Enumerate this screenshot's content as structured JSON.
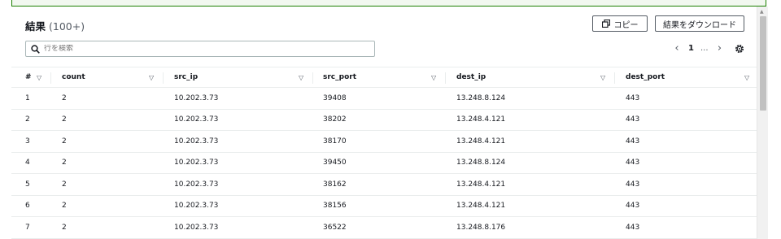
{
  "header": {
    "title": "結果",
    "count": "(100+)"
  },
  "buttons": {
    "copy": "コピー",
    "download": "結果をダウンロード"
  },
  "search": {
    "placeholder": "行を検索"
  },
  "pagination": {
    "prev": "‹",
    "page": "1",
    "dots": "...",
    "next": "›"
  },
  "table": {
    "columns": [
      "#",
      "count",
      "src_ip",
      "src_port",
      "dest_ip",
      "dest_port"
    ],
    "rows": [
      [
        "1",
        "2",
        "10.202.3.73",
        "39408",
        "13.248.8.124",
        "443"
      ],
      [
        "2",
        "2",
        "10.202.3.73",
        "38202",
        "13.248.4.121",
        "443"
      ],
      [
        "3",
        "2",
        "10.202.3.73",
        "38170",
        "13.248.4.121",
        "443"
      ],
      [
        "4",
        "2",
        "10.202.3.73",
        "39450",
        "13.248.8.124",
        "443"
      ],
      [
        "5",
        "2",
        "10.202.3.73",
        "38162",
        "13.248.4.121",
        "443"
      ],
      [
        "6",
        "2",
        "10.202.3.73",
        "38156",
        "13.248.4.121",
        "443"
      ],
      [
        "7",
        "2",
        "10.202.3.73",
        "36522",
        "13.248.8.176",
        "443"
      ]
    ]
  },
  "colors": {
    "success_border": "#1d8102",
    "text": "#16191f",
    "muted": "#545b64"
  },
  "icons": {
    "copy": "copy-icon",
    "search": "search-icon",
    "settings": "gear-icon",
    "sort": "sort-triangle-icon"
  }
}
